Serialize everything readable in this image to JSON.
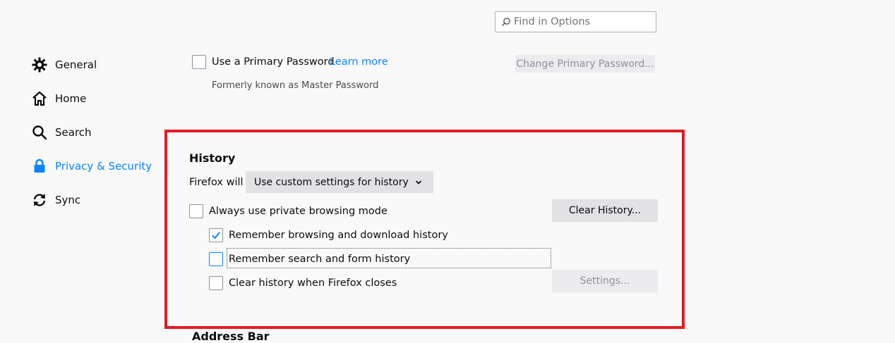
{
  "search": {
    "placeholder": "Find in Options"
  },
  "sidebar": {
    "items": [
      {
        "label": "General",
        "icon": "gear-icon"
      },
      {
        "label": "Home",
        "icon": "home-icon"
      },
      {
        "label": "Search",
        "icon": "search-icon"
      },
      {
        "label": "Privacy & Security",
        "icon": "lock-icon",
        "active": true
      },
      {
        "label": "Sync",
        "icon": "sync-icon"
      }
    ]
  },
  "primary_password": {
    "checkbox_label": "Use a Primary Password",
    "learn_more": "Learn more",
    "note": "Formerly known as Master Password",
    "change_button": "Change Primary Password..."
  },
  "history": {
    "heading": "History",
    "firefox_will": "Firefox will",
    "dropdown_value": "Use custom settings for history",
    "private_mode": {
      "label": "Always use private browsing mode",
      "checked": false
    },
    "clear_history_button": "Clear History...",
    "remember_browsing": {
      "label": "Remember browsing and download history",
      "checked": true
    },
    "remember_search": {
      "label": "Remember search and form history",
      "checked": false
    },
    "clear_on_close": {
      "label": "Clear history when Firefox closes",
      "checked": false
    },
    "settings_button": "Settings..."
  },
  "address_bar": {
    "heading": "Address Bar"
  },
  "colors": {
    "accent": "#0a84ff",
    "highlight": "#e31b23"
  }
}
